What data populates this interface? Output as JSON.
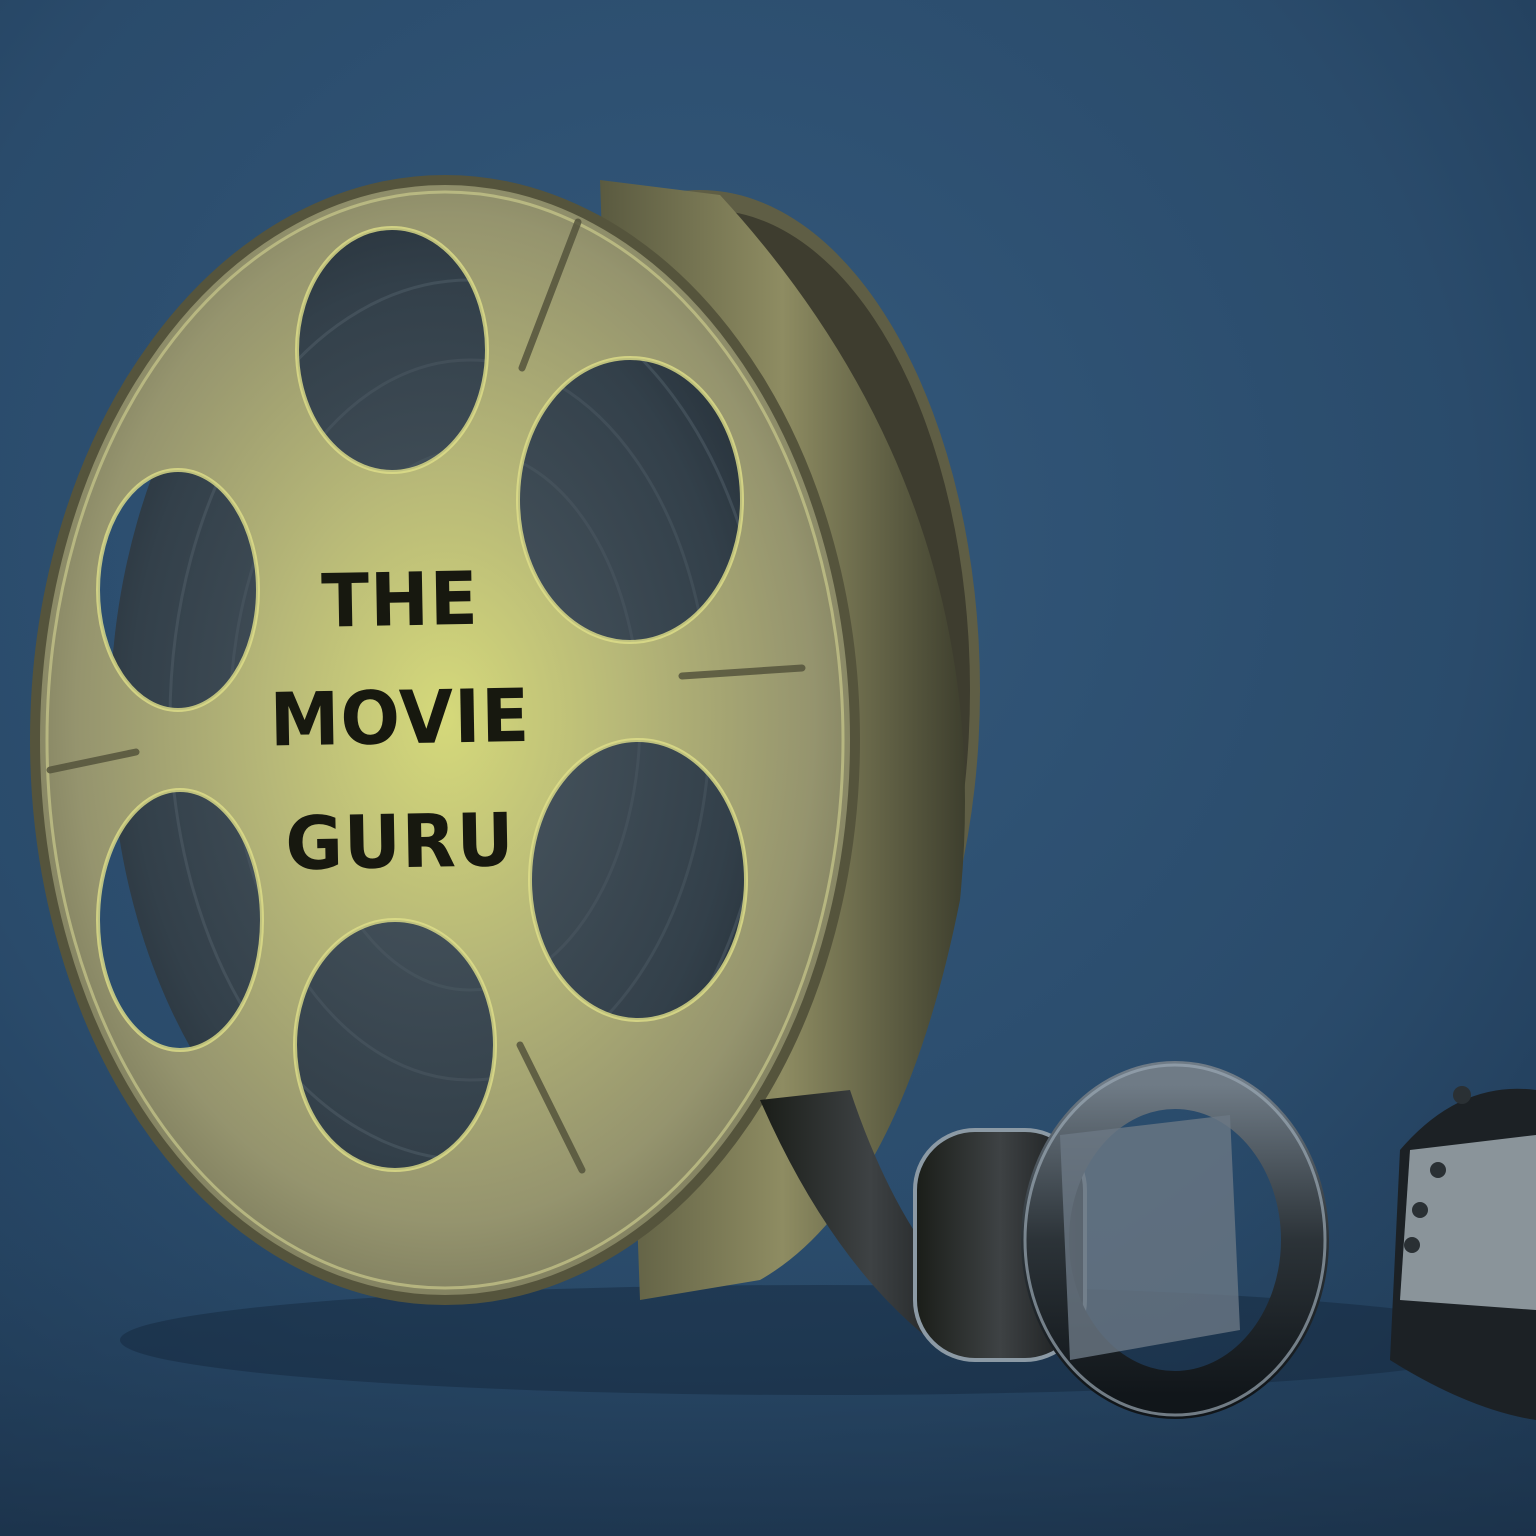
{
  "image": {
    "subject": "film-reel-logo",
    "colors": {
      "background_top": "#2d5478",
      "background_bottom": "#1d3550",
      "reel_metal": "#9e9c72",
      "reel_highlight": "#d7db7a",
      "label_text": "#17180f"
    }
  },
  "reel_label": {
    "line_1": "THE",
    "line_2": "MOVIE",
    "line_3": "GURU"
  }
}
